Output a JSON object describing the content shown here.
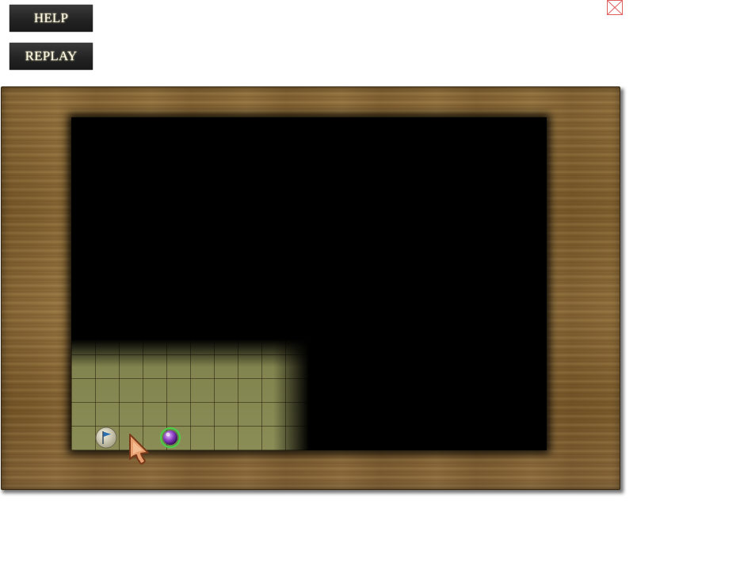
{
  "controls": {
    "help_label": "HELP",
    "replay_label": "REPLAY"
  },
  "icons": {
    "close": "close-icon",
    "flag": "flag-icon",
    "orb": "orb-icon",
    "cursor": "player-cursor-icon"
  },
  "colors": {
    "button_bg": "#222222",
    "button_text": "#fffbe8",
    "wood": "#7b5c2c",
    "grid": "#8a8d56",
    "orb": "#8a3fc0",
    "orb_ring": "#4ad04a",
    "flag": "#2a6fb0"
  }
}
